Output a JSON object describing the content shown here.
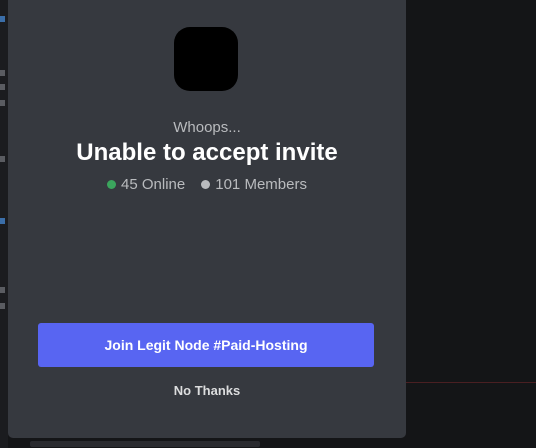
{
  "modal": {
    "subtitle": "Whoops...",
    "title": "Unable to accept invite",
    "stats": {
      "online": "45 Online",
      "members": "101 Members",
      "online_color": "#3ba55d",
      "members_color": "#b9bbbe"
    },
    "join_label": "Join Legit Node #Paid-Hosting",
    "dismiss_label": "No Thanks",
    "accent_color": "#5865f2"
  }
}
